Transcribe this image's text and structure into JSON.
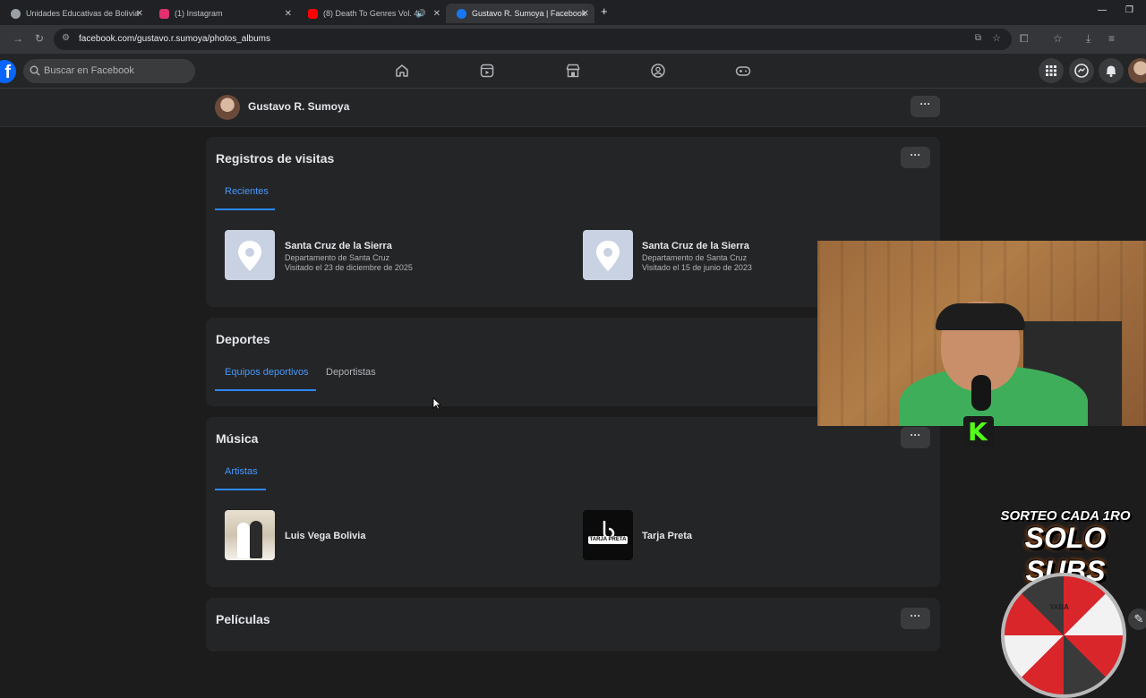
{
  "browser": {
    "tabs": [
      {
        "title": "Unidades Educativas de Bolivia",
        "favicon_color": "#9aa0a6"
      },
      {
        "title": "(1) Instagram",
        "favicon_color": "#e1306c"
      },
      {
        "title": "(8) Death To Genres Vol. 4 -",
        "favicon_color": "#ff0000"
      },
      {
        "title": "Gustavo R. Sumoya | Facebook",
        "favicon_color": "#1877f2"
      }
    ],
    "url": "facebook.com/gustavo.r.sumoya/photos_albums"
  },
  "fb_header": {
    "logo": "f",
    "search_placeholder": "Buscar en Facebook",
    "nav_icons": [
      "home-icon",
      "video-icon",
      "marketplace-icon",
      "groups-icon",
      "gaming-icon"
    ],
    "right_icons": [
      "menu-grid-icon",
      "messenger-icon",
      "notifications-icon",
      "profile-avatar"
    ]
  },
  "profile": {
    "name": "Gustavo R. Sumoya",
    "more": "···"
  },
  "sections": {
    "visits": {
      "title": "Registros de visitas",
      "more": "···",
      "tabs": [
        "Recientes"
      ],
      "items": [
        {
          "title": "Santa Cruz de la Sierra",
          "region": "Departamento de Santa Cruz",
          "visited": "Visitado el 23 de diciembre de 2025"
        },
        {
          "title": "Santa Cruz de la Sierra",
          "region": "Departamento de Santa Cruz",
          "visited": "Visitado el 15 de junio de 2023"
        }
      ]
    },
    "sports": {
      "title": "Deportes",
      "tabs": [
        "Equipos deportivos",
        "Deportistas"
      ]
    },
    "music": {
      "title": "Música",
      "more": "···",
      "tabs": [
        "Artistas"
      ],
      "items": [
        {
          "title": "Luis Vega Bolivia"
        },
        {
          "title": "Tarja Preta",
          "logo_text": "TARJA PRETA"
        }
      ]
    },
    "movies": {
      "title": "Películas",
      "more": "···"
    }
  },
  "stream_overlay": {
    "kick_letter": "K",
    "promo_line1": "SORTEO CADA 1RO",
    "promo_line2": "SOLO SUBS",
    "wheel_label": "YABA"
  },
  "colors": {
    "fb_blue": "#0866ff",
    "tab_selected": "#4599ff",
    "kick_green": "#53fc18"
  }
}
